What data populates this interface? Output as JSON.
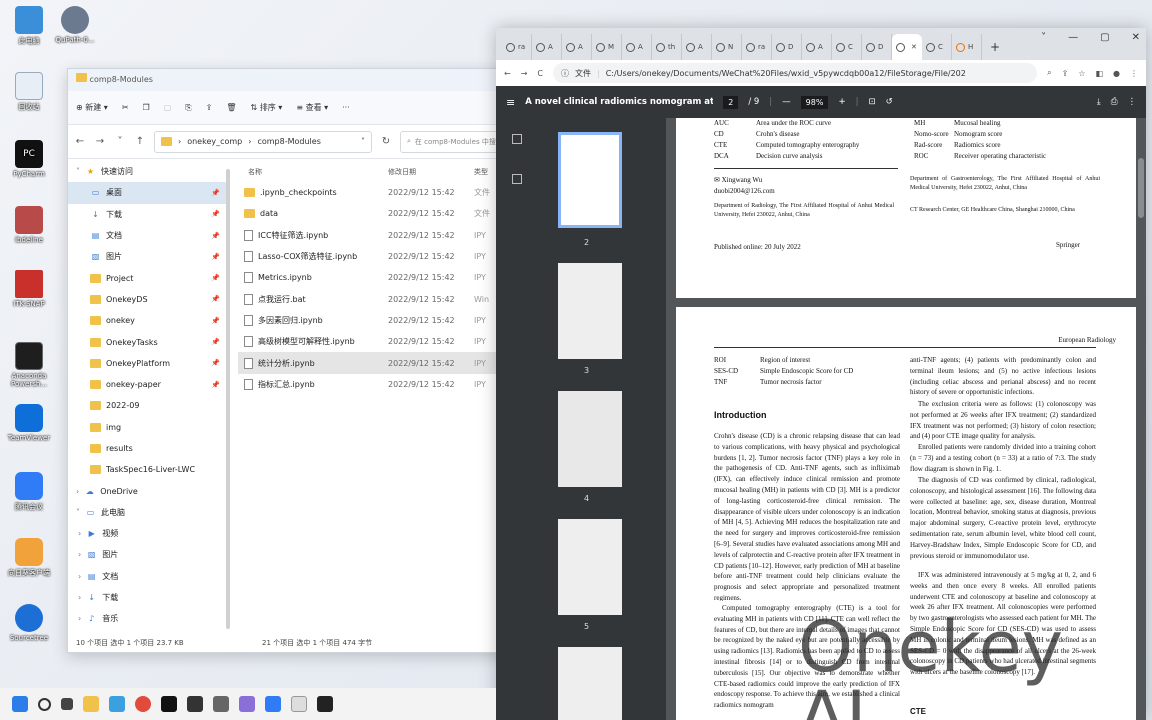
{
  "desktop": {
    "icons": [
      {
        "label": "此电脑"
      },
      {
        "label": "回收站"
      },
      {
        "label": "PyCharm"
      },
      {
        "label": "ibdeline"
      },
      {
        "label": "ITK-SNAP"
      },
      {
        "label": "Anaconda Powersh..."
      },
      {
        "label": "TeamViewer"
      },
      {
        "label": "腾讯会议"
      },
      {
        "label": "向日葵客户端"
      },
      {
        "label": "Sourcetree"
      }
    ],
    "top_icon2": {
      "label": "QuPath-0..."
    }
  },
  "explorer": {
    "title": "comp8-Modules",
    "toolbar": {
      "new": "新建",
      "sort": "排序",
      "view": "查看",
      "more": "···"
    },
    "breadcrumb": [
      "onekey_comp",
      "comp8-Modules"
    ],
    "search_placeholder": "在 comp8-Modules 中搜索",
    "nav": [
      {
        "label": "快速访问",
        "type": "star"
      },
      {
        "label": "桌面",
        "type": "desktop"
      },
      {
        "label": "下载",
        "type": "download"
      },
      {
        "label": "文档",
        "type": "doc"
      },
      {
        "label": "图片",
        "type": "pic"
      },
      {
        "label": "Project",
        "type": "folder"
      },
      {
        "label": "OnekeyDS",
        "type": "folder"
      },
      {
        "label": "onekey",
        "type": "folder"
      },
      {
        "label": "OnekeyTasks",
        "type": "folder"
      },
      {
        "label": "OnekeyPlatform",
        "type": "folder"
      },
      {
        "label": "onekey-paper",
        "type": "folder"
      },
      {
        "label": "2022-09",
        "type": "folder"
      },
      {
        "label": "img",
        "type": "folder"
      },
      {
        "label": "results",
        "type": "folder"
      },
      {
        "label": "TaskSpec16-Liver-LWC",
        "type": "folder"
      },
      {
        "label": "OneDrive",
        "type": "cloud"
      },
      {
        "label": "此电脑",
        "type": "pc"
      },
      {
        "label": "视频",
        "type": "video"
      },
      {
        "label": "图片",
        "type": "pic"
      },
      {
        "label": "文档",
        "type": "doc"
      },
      {
        "label": "下载",
        "type": "download"
      },
      {
        "label": "音乐",
        "type": "music"
      }
    ],
    "columns": {
      "name": "名称",
      "date": "修改日期",
      "type": "类型"
    },
    "files": [
      {
        "name": ".ipynb_checkpoints",
        "date": "2022/9/12 15:42",
        "type": "文件",
        "kind": "folder"
      },
      {
        "name": "data",
        "date": "2022/9/12 15:42",
        "type": "文件",
        "kind": "folder"
      },
      {
        "name": "ICC特征筛选.ipynb",
        "date": "2022/9/12 15:42",
        "type": "IPY",
        "kind": "file"
      },
      {
        "name": "Lasso-COX筛选特征.ipynb",
        "date": "2022/9/12 15:42",
        "type": "IPY",
        "kind": "file"
      },
      {
        "name": "Metrics.ipynb",
        "date": "2022/9/12 15:42",
        "type": "IPY",
        "kind": "file"
      },
      {
        "name": "点我运行.bat",
        "date": "2022/9/12 15:42",
        "type": "Win",
        "kind": "bat"
      },
      {
        "name": "多因素回归.ipynb",
        "date": "2022/9/12 15:42",
        "type": "IPY",
        "kind": "file"
      },
      {
        "name": "高级树模型可解释性.ipynb",
        "date": "2022/9/12 15:42",
        "type": "IPY",
        "kind": "file"
      },
      {
        "name": "统计分析.ipynb",
        "date": "2022/9/12 15:42",
        "type": "IPY",
        "kind": "file"
      },
      {
        "name": "指标汇总.ipynb",
        "date": "2022/9/12 15:42",
        "type": "IPY",
        "kind": "file"
      }
    ],
    "status_left": "10 个项目    选中 1 个项目  23.7 KB",
    "status_right": "21 个项目    选中 1 个项目  474 字节"
  },
  "chrome": {
    "tabs": [
      "ra",
      "A",
      "A",
      "M",
      "A",
      "th",
      "A",
      "N",
      "ra",
      "D",
      "A",
      "C",
      "D",
      "",
      "C",
      "H"
    ],
    "url": "C:/Users/onekey/Documents/WeChat%20Files/wxid_v5pywcdqb00a12/FileStorage/File/2022-09/Zhu20...",
    "url_prefix": "文件",
    "pdf_title": "A novel clinical radiomics nomogram at baseline ...",
    "page_current": "2",
    "page_total": "/ 9",
    "zoom": "98%",
    "thumb_labels": [
      "2",
      "3",
      "4",
      "5"
    ]
  },
  "pdf": {
    "abbr_top": [
      [
        "AUC",
        "Area under the ROC curve",
        "MH",
        "Mucosal healing"
      ],
      [
        "CD",
        "Crohn's disease",
        "Nomo-score",
        "Nomogram score"
      ],
      [
        "CTE",
        "Computed tomography enterography",
        "Rad-score",
        "Radiomics score"
      ],
      [
        "DCA",
        "Decision curve analysis",
        "ROC",
        "Receiver operating characteristic"
      ]
    ],
    "author": "Xingwang Wu",
    "email": "duobi2004@126.com",
    "aff1": "Department of Radiology, The First Affiliated Hospital of Anhui Medical University, Hefei 230022, Anhui, China",
    "aff2": "Department of Gastroenterology, The First Affiliated Hospital of Anhui Medical University, Hefei 230022, Anhui, China",
    "aff3": "CT Research Center, GE Healthcare China, Shanghai 210000, China",
    "published": "Published online: 20 July 2022",
    "springer": "Springer",
    "journal": "European Radiology",
    "abbr_bottom": [
      [
        "ROI",
        "Region of interest"
      ],
      [
        "SES-CD",
        "Simple Endoscopic Score for CD"
      ],
      [
        "TNF",
        "Tumor necrosis factor"
      ]
    ],
    "intro_heading": "Introduction",
    "intro_text": "Crohn's disease (CD) is a chronic relapsing disease that can lead to various complications, with heavy physical and psychological burdens [1, 2]. Tumor necrosis factor (TNF) plays a key role in the pathogenesis of CD. Anti-TNF agents, such as infliximab (IFX), can effectively induce clinical remission and promote mucosal healing (MH) in patients with CD [3]. MH is a predictor of long-lasting corticosteroid-free clinical remission. The disappearance of visible ulcers under colonoscopy is an indication of MH [4, 5]. Achieving MH reduces the hospitalization rate and the need for surgery and improves corticosteroid-free remission [6–9]. Several studies have evaluated associations among MH and levels of calprotectin and C-reactive protein after IFX treatment in CD patients [10–12]. However, early prediction of MH at baseline before anti-TNF treatment could help clinicians evaluate the prognosis and select appropriate and personalized treatment regimens.",
    "intro_text2": "Computed tomography enterography (CTE) is a tool for evaluating MH in patients with CD [11]. CTE can well reflect the features of CD, but there are internal details of images that cannot be recognized by the naked eye but are potentially accessible by using radiomics [13]. Radiomics has been applied to CD to assess intestinal fibrosis [14] or to distinguish CD from intestinal tuberculosis [15]. Our objective was to demonstrate whether CTE-based radiomics could improve the early prediction of IFX endoscopy response. To achieve this aim, we established a clinical radiomics nomogram",
    "right_text1": "anti-TNF agents; (4) patients with predominantly colon and terminal ileum lesions; and (5) no active infectious lesions (including celiac abscess and perianal abscess) and no recent history of severe or opportunistic infections.",
    "right_text2": "The exclusion criteria were as follows: (1) colonoscopy was not performed at 26 weeks after IFX treatment; (2) standardized IFX treatment was not performed; (3) history of colon resection; and (4) poor CTE image quality for analysis.",
    "right_text3": "Enrolled patients were randomly divided into a training cohort (n = 73) and a testing cohort (n = 33) at a ratio of 7:3. The study flow diagram is shown in Fig. 1.",
    "right_text4": "The diagnosis of CD was confirmed by clinical, radiological, colonoscopy, and histological assessment [16]. The following data were collected at baseline: age, sex, disease duration, Montreal location, Montreal behavior, smoking status at diagnosis, previous major abdominal surgery, C-reactive protein level, erythrocyte sedimentation rate, serum albumin level, white blood cell count, Harvey-Bradshaw Index, Simple Endoscopic Score for CD, and previous steroid or immunomodulator use.",
    "right_text5": "IFX was administered intravenously at 5 mg/kg at 0, 2, and 6 weeks and then once every 8 weeks. All enrolled patients underwent CTE and colonoscopy at baseline and colonoscopy at week 26 after IFX treatment. All colonoscopies were performed by two gastroenterologists who assessed each patient for MH. The Simple Endoscopic Score for CD (SES-CD) was used to assess MH in colonic and terminal ileum lesions. MH was defined as an SES-CD = 0 with the disappearance of all ulcers at the 26-week colonoscopy in CD patients who had ulcerated intestinal segments with ulcers at the baseline colonoscopy [17].",
    "cte_heading": "CTE"
  },
  "watermark": "Onekey AI"
}
